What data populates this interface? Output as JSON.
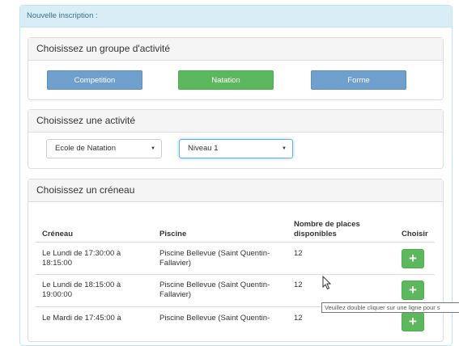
{
  "header": {
    "title": "Nouvelle inscription :"
  },
  "group_panel": {
    "title": "Choisissez un groupe d'activité",
    "buttons": [
      {
        "label": "Competition",
        "active": false
      },
      {
        "label": "Natation",
        "active": true
      },
      {
        "label": "Forme",
        "active": false
      }
    ]
  },
  "activity_panel": {
    "title": "Choisissez une activité",
    "select_activity": "Ecole de Natation",
    "select_level": "Niveau 1"
  },
  "slot_panel": {
    "title": "Choisissez un créneau",
    "columns": {
      "creneau": "Créneau",
      "piscine": "Piscine",
      "places_line1": "Nombre de places",
      "places_line2": "disponibles",
      "choisir": "Choisir"
    },
    "rows": [
      {
        "creneau_1": "Le Lundi de 17:30:00 à",
        "creneau_2": "18:15:00",
        "piscine_1": "Piscine Bellevue (Saint Quentin-",
        "piscine_2": "Fallavier)",
        "places": "12",
        "action": "+"
      },
      {
        "creneau_1": "Le Lundi de 18:15:00 à",
        "creneau_2": "19:00:00",
        "piscine_1": "Piscine Bellevue (Saint Quentin-",
        "piscine_2": "Fallavier)",
        "places": "12",
        "action": "+"
      },
      {
        "creneau_1": "Le Mardi de 17:45:00 à",
        "creneau_2": "",
        "piscine_1": "Piscine Bellevue (Saint Quentin-",
        "piscine_2": "",
        "places": "12",
        "action": "+"
      }
    ]
  },
  "tooltip": "Veuillez double cliquer sur une ligne pour s",
  "colors": {
    "info_bg": "#d9edf7",
    "success": "#5cb85c",
    "primary_muted": "#6f9fcc"
  }
}
